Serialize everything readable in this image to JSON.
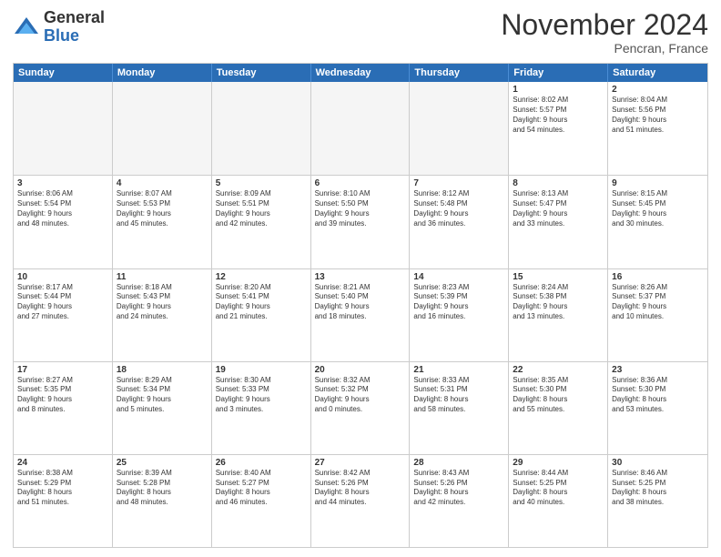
{
  "logo": {
    "general": "General",
    "blue": "Blue"
  },
  "header": {
    "month": "November 2024",
    "location": "Pencran, France"
  },
  "weekdays": [
    "Sunday",
    "Monday",
    "Tuesday",
    "Wednesday",
    "Thursday",
    "Friday",
    "Saturday"
  ],
  "rows": [
    [
      {
        "day": "",
        "info": "",
        "empty": true
      },
      {
        "day": "",
        "info": "",
        "empty": true
      },
      {
        "day": "",
        "info": "",
        "empty": true
      },
      {
        "day": "",
        "info": "",
        "empty": true
      },
      {
        "day": "",
        "info": "",
        "empty": true
      },
      {
        "day": "1",
        "info": "Sunrise: 8:02 AM\nSunset: 5:57 PM\nDaylight: 9 hours\nand 54 minutes.",
        "empty": false
      },
      {
        "day": "2",
        "info": "Sunrise: 8:04 AM\nSunset: 5:56 PM\nDaylight: 9 hours\nand 51 minutes.",
        "empty": false
      }
    ],
    [
      {
        "day": "3",
        "info": "Sunrise: 8:06 AM\nSunset: 5:54 PM\nDaylight: 9 hours\nand 48 minutes.",
        "empty": false
      },
      {
        "day": "4",
        "info": "Sunrise: 8:07 AM\nSunset: 5:53 PM\nDaylight: 9 hours\nand 45 minutes.",
        "empty": false
      },
      {
        "day": "5",
        "info": "Sunrise: 8:09 AM\nSunset: 5:51 PM\nDaylight: 9 hours\nand 42 minutes.",
        "empty": false
      },
      {
        "day": "6",
        "info": "Sunrise: 8:10 AM\nSunset: 5:50 PM\nDaylight: 9 hours\nand 39 minutes.",
        "empty": false
      },
      {
        "day": "7",
        "info": "Sunrise: 8:12 AM\nSunset: 5:48 PM\nDaylight: 9 hours\nand 36 minutes.",
        "empty": false
      },
      {
        "day": "8",
        "info": "Sunrise: 8:13 AM\nSunset: 5:47 PM\nDaylight: 9 hours\nand 33 minutes.",
        "empty": false
      },
      {
        "day": "9",
        "info": "Sunrise: 8:15 AM\nSunset: 5:45 PM\nDaylight: 9 hours\nand 30 minutes.",
        "empty": false
      }
    ],
    [
      {
        "day": "10",
        "info": "Sunrise: 8:17 AM\nSunset: 5:44 PM\nDaylight: 9 hours\nand 27 minutes.",
        "empty": false
      },
      {
        "day": "11",
        "info": "Sunrise: 8:18 AM\nSunset: 5:43 PM\nDaylight: 9 hours\nand 24 minutes.",
        "empty": false
      },
      {
        "day": "12",
        "info": "Sunrise: 8:20 AM\nSunset: 5:41 PM\nDaylight: 9 hours\nand 21 minutes.",
        "empty": false
      },
      {
        "day": "13",
        "info": "Sunrise: 8:21 AM\nSunset: 5:40 PM\nDaylight: 9 hours\nand 18 minutes.",
        "empty": false
      },
      {
        "day": "14",
        "info": "Sunrise: 8:23 AM\nSunset: 5:39 PM\nDaylight: 9 hours\nand 16 minutes.",
        "empty": false
      },
      {
        "day": "15",
        "info": "Sunrise: 8:24 AM\nSunset: 5:38 PM\nDaylight: 9 hours\nand 13 minutes.",
        "empty": false
      },
      {
        "day": "16",
        "info": "Sunrise: 8:26 AM\nSunset: 5:37 PM\nDaylight: 9 hours\nand 10 minutes.",
        "empty": false
      }
    ],
    [
      {
        "day": "17",
        "info": "Sunrise: 8:27 AM\nSunset: 5:35 PM\nDaylight: 9 hours\nand 8 minutes.",
        "empty": false
      },
      {
        "day": "18",
        "info": "Sunrise: 8:29 AM\nSunset: 5:34 PM\nDaylight: 9 hours\nand 5 minutes.",
        "empty": false
      },
      {
        "day": "19",
        "info": "Sunrise: 8:30 AM\nSunset: 5:33 PM\nDaylight: 9 hours\nand 3 minutes.",
        "empty": false
      },
      {
        "day": "20",
        "info": "Sunrise: 8:32 AM\nSunset: 5:32 PM\nDaylight: 9 hours\nand 0 minutes.",
        "empty": false
      },
      {
        "day": "21",
        "info": "Sunrise: 8:33 AM\nSunset: 5:31 PM\nDaylight: 8 hours\nand 58 minutes.",
        "empty": false
      },
      {
        "day": "22",
        "info": "Sunrise: 8:35 AM\nSunset: 5:30 PM\nDaylight: 8 hours\nand 55 minutes.",
        "empty": false
      },
      {
        "day": "23",
        "info": "Sunrise: 8:36 AM\nSunset: 5:30 PM\nDaylight: 8 hours\nand 53 minutes.",
        "empty": false
      }
    ],
    [
      {
        "day": "24",
        "info": "Sunrise: 8:38 AM\nSunset: 5:29 PM\nDaylight: 8 hours\nand 51 minutes.",
        "empty": false
      },
      {
        "day": "25",
        "info": "Sunrise: 8:39 AM\nSunset: 5:28 PM\nDaylight: 8 hours\nand 48 minutes.",
        "empty": false
      },
      {
        "day": "26",
        "info": "Sunrise: 8:40 AM\nSunset: 5:27 PM\nDaylight: 8 hours\nand 46 minutes.",
        "empty": false
      },
      {
        "day": "27",
        "info": "Sunrise: 8:42 AM\nSunset: 5:26 PM\nDaylight: 8 hours\nand 44 minutes.",
        "empty": false
      },
      {
        "day": "28",
        "info": "Sunrise: 8:43 AM\nSunset: 5:26 PM\nDaylight: 8 hours\nand 42 minutes.",
        "empty": false
      },
      {
        "day": "29",
        "info": "Sunrise: 8:44 AM\nSunset: 5:25 PM\nDaylight: 8 hours\nand 40 minutes.",
        "empty": false
      },
      {
        "day": "30",
        "info": "Sunrise: 8:46 AM\nSunset: 5:25 PM\nDaylight: 8 hours\nand 38 minutes.",
        "empty": false
      }
    ]
  ]
}
